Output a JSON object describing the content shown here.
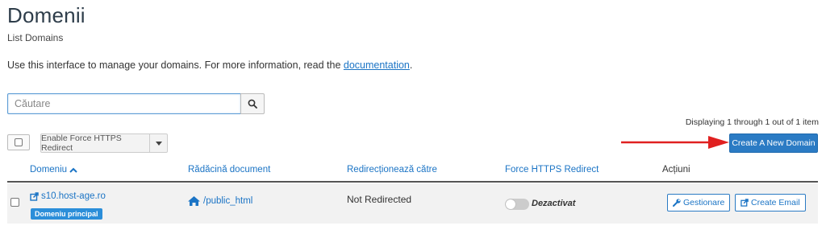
{
  "header": {
    "title": "Domenii",
    "subtitle": "List Domains",
    "intro_text": "Use this interface to manage your domains. For more information, read the ",
    "intro_link": "documentation",
    "intro_end": "."
  },
  "search": {
    "placeholder": "Căutare",
    "value": ""
  },
  "pagination": {
    "displaying": "Displaying 1 through 1 out of 1 item"
  },
  "toolbar": {
    "https_redirect_label": "Enable Force HTTPS Redirect",
    "create_domain_label": "Create A New Domain"
  },
  "table": {
    "columns": {
      "domain": "Domeniu",
      "docroot": "Rădăcină document",
      "redirects": "Redirecționează către",
      "https": "Force HTTPS Redirect",
      "actions": "Acțiuni"
    },
    "rows": [
      {
        "domain": "s10.host-age.ro",
        "badge": "Domeniu principal",
        "docroot": "/public_html",
        "redirect": "Not Redirected",
        "https_status": "Dezactivat",
        "manage_label": "Gestionare",
        "email_label": "Create Email"
      }
    ]
  },
  "colors": {
    "accent": "#2b7bc4",
    "link": "#1b74c5",
    "arrow": "#e02020"
  }
}
